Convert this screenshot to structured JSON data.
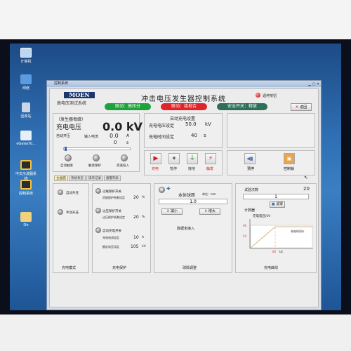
{
  "window": {
    "title": "控制系统"
  },
  "desktop": {
    "icons": [
      {
        "label": "计算机"
      },
      {
        "label": "网络"
      },
      {
        "label": "回收站"
      },
      {
        "label": "eGalaxTo..."
      },
      {
        "label": "中文示波器系统"
      },
      {
        "label": "控制系统"
      },
      {
        "label": "Dir"
      }
    ]
  },
  "header": {
    "logo": "MOEN",
    "subtitle": "高电压测试系统",
    "app_title": "冲击电压发生器控制系统",
    "status_pills": [
      {
        "label": "联动：高压分",
        "color": "#1ea33a"
      },
      {
        "label": "联动：接地合",
        "color": "#e0242a"
      },
      {
        "label": "安全开关：释放",
        "color": "#2d6f5a"
      }
    ],
    "emergency_label": "遇停按钮",
    "return_button": "返回"
  },
  "charge_panel": {
    "device_label": "（发生器每级）",
    "charge_voltage_label": "充电电压",
    "charge_voltage_value": "0.0 kV",
    "auto_switch_label": "自动开压",
    "input_current_label": "输入电流",
    "input_current_value": "0.0",
    "input_current_unit": "A",
    "timer_value": "0",
    "timer_unit": "s",
    "slider_level": 0.02,
    "knobs": [
      "自动触发",
      "触发保护",
      "高速投入"
    ]
  },
  "auto_charge_panel": {
    "title": "自动充电设置",
    "voltage_label": "充电电压设定",
    "voltage_value": "50.0",
    "voltage_unit": "kV",
    "time_label": "充电时间设定",
    "time_value": "40",
    "time_unit": "s",
    "buttons": [
      {
        "label": "充电",
        "icon": "play-icon",
        "color": "#d01a1a"
      },
      {
        "label": "暂停",
        "icon": "pause-icon",
        "color": "#333333"
      },
      {
        "label": "接地",
        "icon": "ground-icon",
        "color": "#333333"
      },
      {
        "label": "触发",
        "icon": "lightning-icon",
        "color": "#d01a1a"
      }
    ]
  },
  "side_buttons": [
    {
      "label": "预停"
    },
    {
      "label": "控制锁"
    }
  ],
  "tabs": [
    {
      "label": "主画面",
      "active": true
    },
    {
      "label": "系统状态",
      "active": false
    },
    {
      "label": "操作记录",
      "active": false
    },
    {
      "label": "报警列表",
      "active": false
    }
  ],
  "charge_mode_panel": {
    "items": [
      "自动升压",
      "手动升压"
    ],
    "footer": "充电模式"
  },
  "charge_protect_panel": {
    "items": [
      {
        "label": "过载保护开关",
        "sub": "泄放保护系数设定",
        "value": "20",
        "unit": "%"
      },
      {
        "label": "过压保护开关",
        "sub": "过压保护系数设定",
        "value": "20",
        "unit": "%"
      },
      {
        "label": "自动充电开关",
        "sub": "充电电流设定",
        "value": "10",
        "unit": "A"
      },
      {
        "label": "",
        "sub": "额定电压设定",
        "value": "105",
        "unit": "kV"
      }
    ],
    "footer": "充电保护"
  },
  "ball_gap_panel": {
    "motor_label": "M",
    "title": "本体球距",
    "unit": "单位：mm",
    "value": "1.0",
    "decrease": "减小",
    "increase": "增大",
    "status": "数据未接入",
    "footer": "球隙调整"
  },
  "test_panel": {
    "count_label": "试验次数",
    "count_value": "20",
    "count_input": "1",
    "clear_button": "清零",
    "counter_label": "计数器",
    "plot_title": "充电电压/kV",
    "plot_ymax": "90",
    "plot_ymid": "50",
    "plot_x1": "80",
    "plot_x2": "t/s",
    "plot_xlabel": "充电时间/s",
    "footer": "充电曲线"
  }
}
